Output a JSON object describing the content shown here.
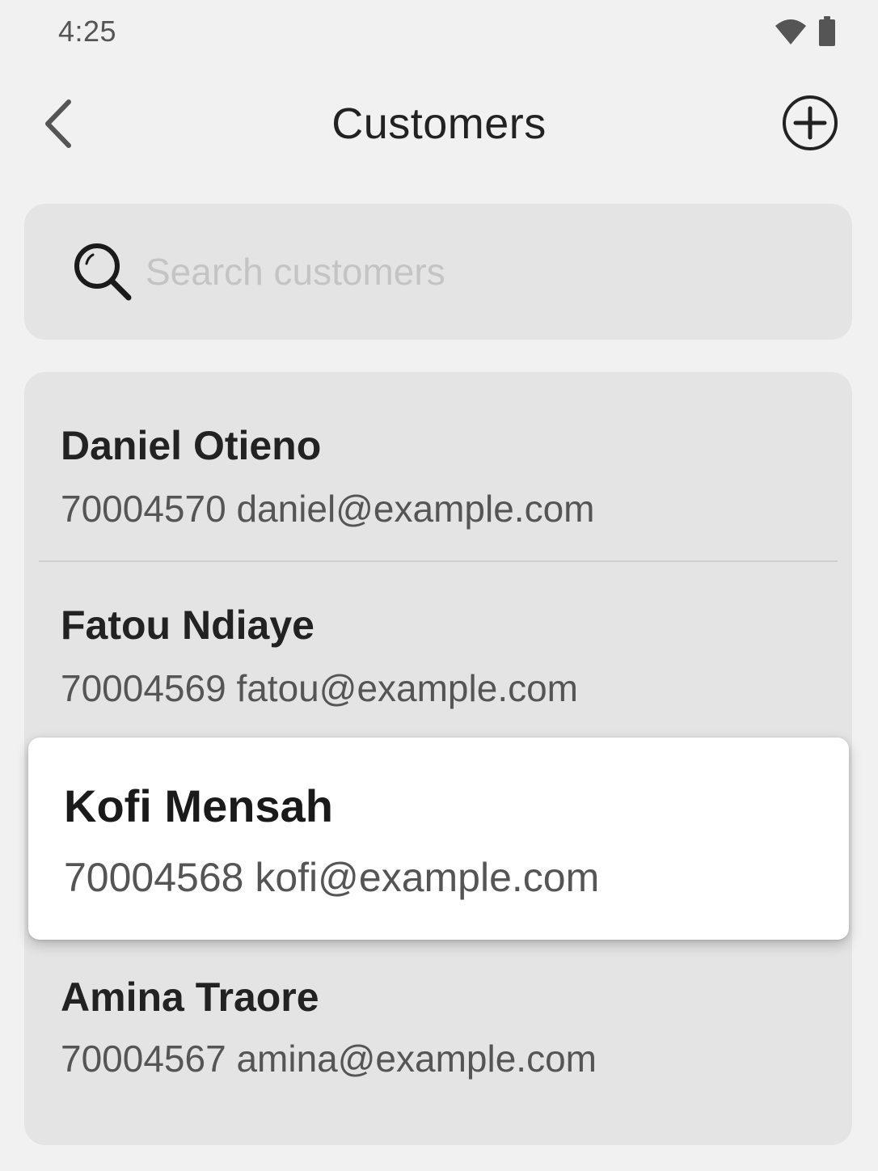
{
  "status_bar": {
    "time": "4:25",
    "icons": [
      "wifi-icon",
      "battery-icon"
    ]
  },
  "app_bar": {
    "title": "Customers",
    "back_icon": "chevron-left-icon",
    "add_icon": "plus-circle-icon"
  },
  "search": {
    "placeholder": "Search customers",
    "value": "",
    "icon": "search-icon"
  },
  "customers": [
    {
      "name": "Daniel Otieno",
      "id": "70004570",
      "email": "daniel@example.com",
      "subtitle": "70004570 daniel@example.com"
    },
    {
      "name": "Fatou Ndiaye",
      "id": "70004569",
      "email": "fatou@example.com",
      "subtitle": "70004569 fatou@example.com"
    },
    {
      "name": "Kofi Mensah",
      "id": "70004568",
      "email": "kofi@example.com",
      "subtitle": "70004568 kofi@example.com",
      "highlighted": true
    },
    {
      "name": "Amina Traore",
      "id": "70004567",
      "email": "amina@example.com",
      "subtitle": "70004567 amina@example.com"
    }
  ],
  "colors": {
    "background": "#f1f1f1",
    "surface": "#e4e4e4",
    "highlight_surface": "#ffffff",
    "text_primary": "#222222",
    "text_secondary": "#555555",
    "placeholder": "#c4c4c4"
  }
}
